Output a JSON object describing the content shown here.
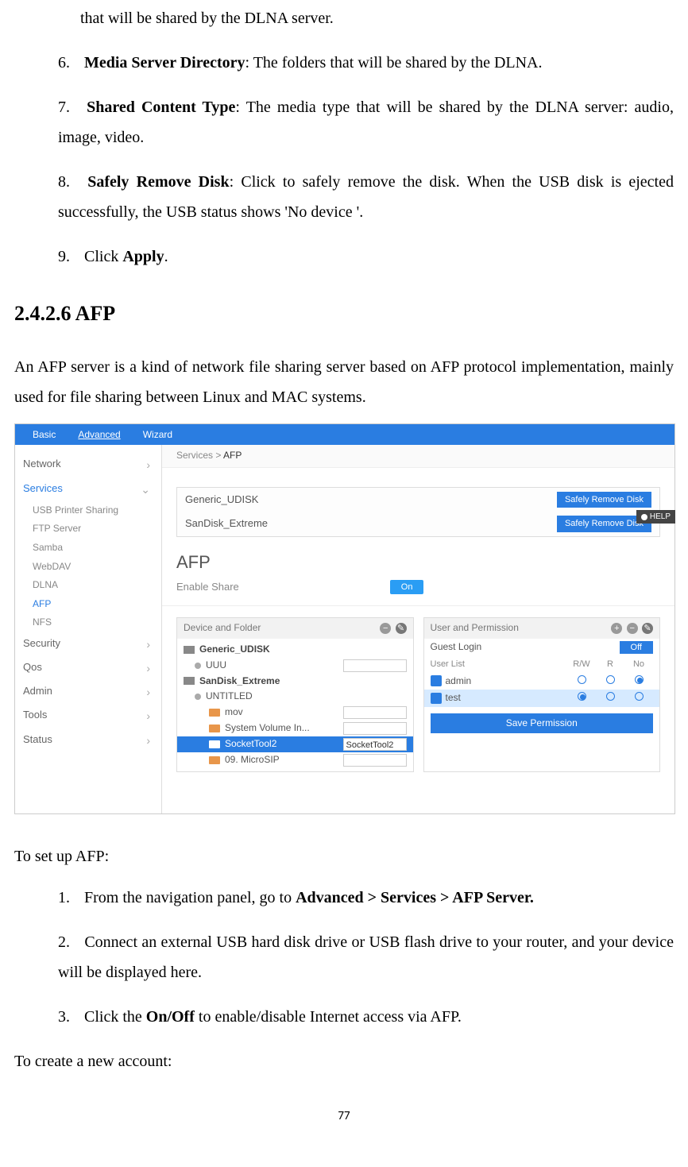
{
  "items_prev": {
    "text": "that will be shared by the DLNA server."
  },
  "list_top": [
    {
      "n": "6.",
      "bold": "Media Server Directory",
      "rest": ": The folders that will be shared by the DLNA."
    },
    {
      "n": "7.",
      "bold": "Shared Content Type",
      "rest": ": The media type that will be shared by the DLNA server: audio, image, video."
    },
    {
      "n": "8.",
      "bold": "Safely Remove Disk",
      "rest": ": Click to safely remove the disk. When the USB disk is ejected successfully, the USB status shows 'No device '."
    },
    {
      "n": "9.",
      "pre": "Click ",
      "bold": "Apply",
      "rest": "."
    }
  ],
  "section_heading": "2.4.2.6 AFP",
  "intro_para": "An AFP server is a kind of network file sharing server based on AFP protocol implementation, mainly used for file sharing between Linux and MAC systems.",
  "ui": {
    "tabs": [
      "Basic",
      "Advanced",
      "Wizard"
    ],
    "active_tab": "Advanced",
    "breadcrumb_prefix": "Services > ",
    "breadcrumb_current": "AFP",
    "sidebar": {
      "cats": [
        {
          "label": "Network",
          "expanded": false
        },
        {
          "label": "Services",
          "expanded": true,
          "active": true,
          "subs": [
            "USB Printer Sharing",
            "FTP Server",
            "Samba",
            "WebDAV",
            "DLNA",
            "AFP",
            "NFS"
          ],
          "active_sub": "AFP"
        },
        {
          "label": "Security",
          "expanded": false
        },
        {
          "label": "Qos",
          "expanded": false
        },
        {
          "label": "Admin",
          "expanded": false
        },
        {
          "label": "Tools",
          "expanded": false
        },
        {
          "label": "Status",
          "expanded": false
        }
      ]
    },
    "disks": [
      {
        "name": "Generic_UDISK",
        "btn": "Safely Remove Disk"
      },
      {
        "name": "SanDisk_Extreme",
        "btn": "Safely Remove Disk"
      }
    ],
    "panel_title": "AFP",
    "enable_label": "Enable Share",
    "enable_state": "On",
    "left_panel": {
      "title": "Device and Folder",
      "tree": [
        {
          "type": "disk",
          "label": "Generic_UDISK",
          "indent": 0
        },
        {
          "type": "dot",
          "label": "UUU",
          "indent": 1,
          "input": true
        },
        {
          "type": "disk",
          "label": "SanDisk_Extreme",
          "indent": 0
        },
        {
          "type": "dot",
          "label": "UNTITLED",
          "indent": 1
        },
        {
          "type": "folder",
          "label": "mov",
          "indent": 2,
          "input": true
        },
        {
          "type": "folder",
          "label": "System Volume In...",
          "indent": 2,
          "input": true
        },
        {
          "type": "folder",
          "label": "SocketTool2",
          "indent": 2,
          "selected": true,
          "input_val": "SocketTool2"
        },
        {
          "type": "folder",
          "label": "09. MicroSIP",
          "indent": 2,
          "input": true
        }
      ]
    },
    "right_panel": {
      "title": "User and Permission",
      "guest_label": "Guest Login",
      "guest_state": "Off",
      "userlist_label": "User List",
      "cols": [
        "R/W",
        "R",
        "No"
      ],
      "users": [
        {
          "name": "admin",
          "sel": 2,
          "hl": false
        },
        {
          "name": "test",
          "sel": 0,
          "hl": true
        }
      ],
      "save_btn": "Save Permission"
    },
    "help_label": "HELP"
  },
  "setup_intro": "To set up AFP:",
  "setup_steps": [
    {
      "n": "1.",
      "pre": "From the navigation panel, go to ",
      "bold": "Advanced > Services > AFP Server."
    },
    {
      "n": "2.",
      "text": "Connect an external USB hard disk drive or USB flash drive to your router, and your device will be displayed here."
    },
    {
      "n": "3.",
      "pre": "Click the ",
      "bold": "On/Off",
      "rest": " to enable/disable Internet access via AFP."
    }
  ],
  "create_intro": "To create a new account:",
  "page_number": "77"
}
